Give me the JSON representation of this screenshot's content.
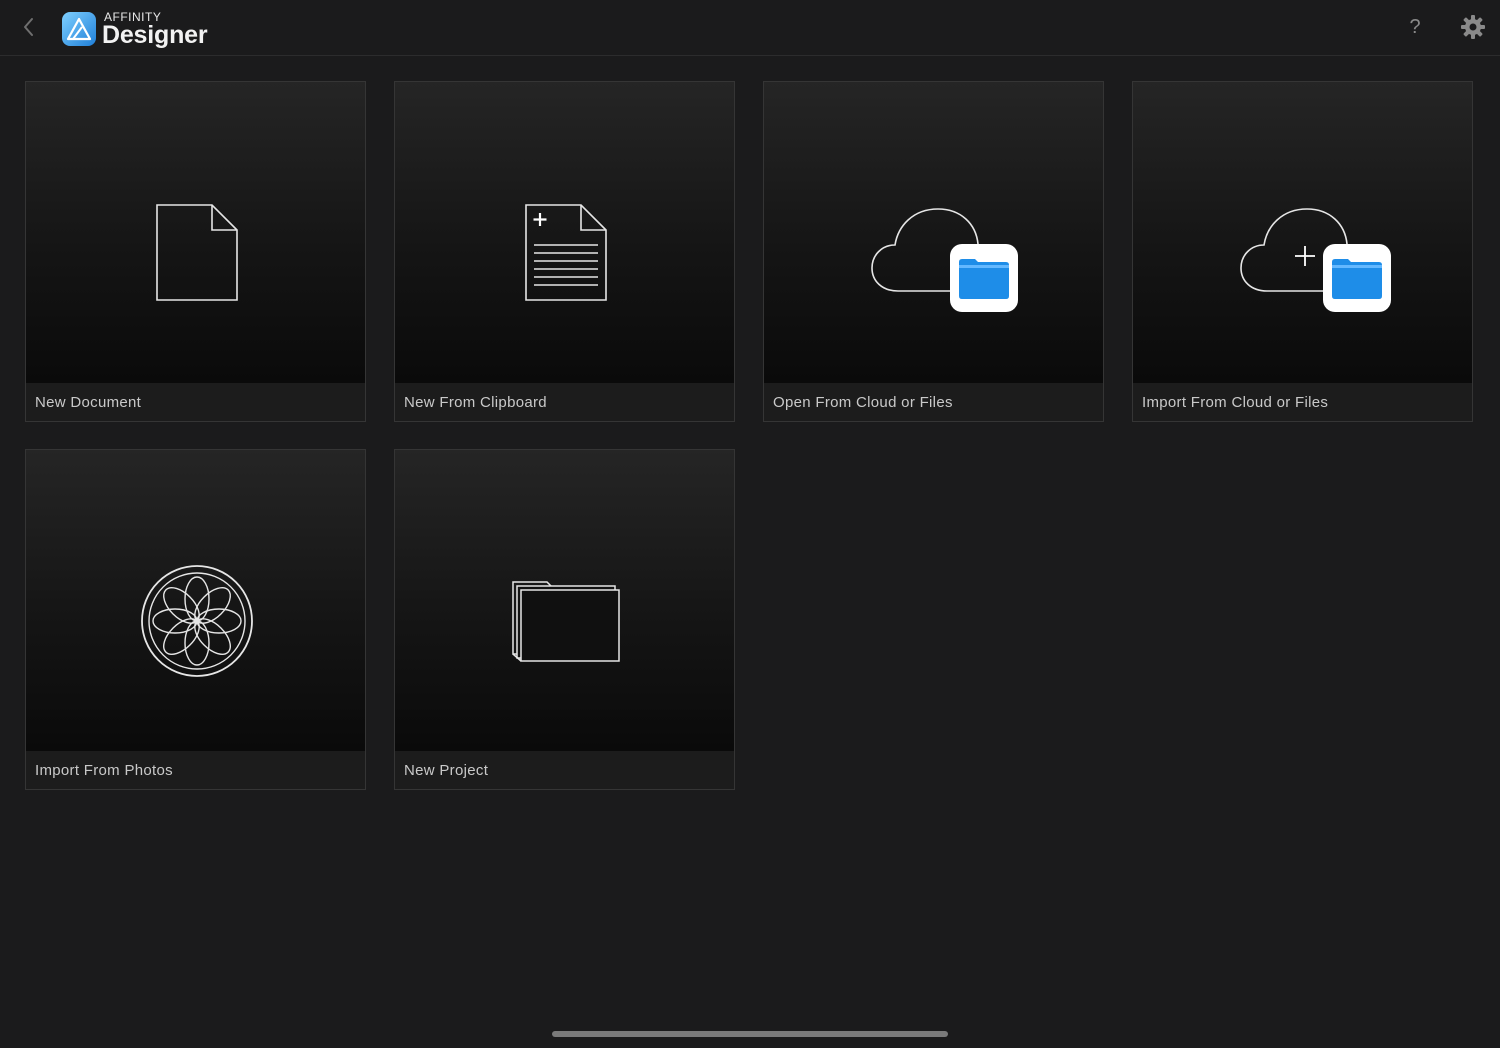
{
  "app": {
    "brand_small": "AFFINITY",
    "brand_name": "Designer",
    "help_label": "?",
    "accent_color": "#2f9bf0"
  },
  "tiles": [
    {
      "label": "New Document",
      "icon": "document-icon"
    },
    {
      "label": "New From Clipboard",
      "icon": "clipboard-document-icon"
    },
    {
      "label": "Open From Cloud or Files",
      "icon": "cloud-files-icon"
    },
    {
      "label": "Import From Cloud or Files",
      "icon": "cloud-import-files-icon"
    },
    {
      "label": "Import From Photos",
      "icon": "photos-flower-icon"
    },
    {
      "label": "New Project",
      "icon": "project-folder-icon"
    }
  ]
}
